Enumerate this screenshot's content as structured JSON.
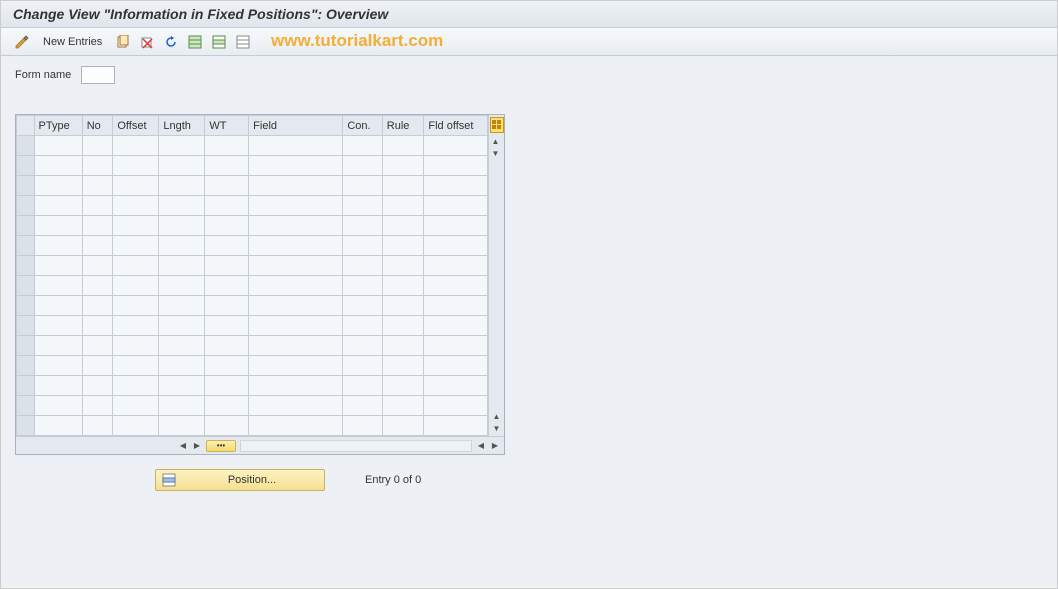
{
  "title": "Change View \"Information in Fixed Positions\": Overview",
  "toolbar": {
    "new_entries": "New Entries"
  },
  "watermark": "www.tutorialkart.com",
  "form": {
    "name_label": "Form name",
    "name_value": ""
  },
  "table": {
    "columns": [
      "PType",
      "No",
      "Offset",
      "Lngth",
      "WT",
      "Field",
      "Con.",
      "Rule",
      "Fld offset"
    ]
  },
  "position_button": "Position...",
  "entry_status": "Entry 0 of 0",
  "hscroll_thumb": "•••"
}
